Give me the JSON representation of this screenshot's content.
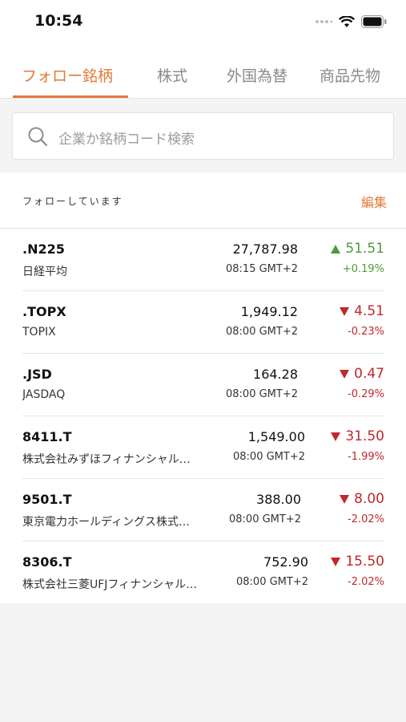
{
  "status_bar": {
    "time": "10:54"
  },
  "tabs": [
    {
      "label": "フォロー銘柄",
      "active": true
    },
    {
      "label": "株式",
      "active": false
    },
    {
      "label": "外国為替",
      "active": false
    },
    {
      "label": "商品先物",
      "active": false
    }
  ],
  "search": {
    "placeholder": "企業か銘柄コード検索"
  },
  "watchlist": {
    "header_label": "フォローしています",
    "edit_label": "編集",
    "rows": [
      {
        "symbol": ".N225",
        "name": "日経平均",
        "price": "27,787.98",
        "time": "08:15 GMT+2",
        "direction": "up",
        "change": "51.51",
        "percent": "+0.19%"
      },
      {
        "symbol": ".TOPX",
        "name": "TOPIX",
        "price": "1,949.12",
        "time": "08:00 GMT+2",
        "direction": "down",
        "change": "4.51",
        "percent": "-0.23%"
      },
      {
        "symbol": ".JSD",
        "name": "JASDAQ",
        "price": "164.28",
        "time": "08:00 GMT+2",
        "direction": "down",
        "change": "0.47",
        "percent": "-0.29%"
      },
      {
        "symbol": "8411.T",
        "name": "株式会社みずほフィナンシャル…",
        "price": "1,549.00",
        "time": "08:00 GMT+2",
        "direction": "down",
        "change": "31.50",
        "percent": "-1.99%"
      },
      {
        "symbol": "9501.T",
        "name": "東京電力ホールディングス株式…",
        "price": "388.00",
        "time": "08:00 GMT+2",
        "direction": "down",
        "change": "8.00",
        "percent": "-2.02%"
      },
      {
        "symbol": "8306.T",
        "name": "株式会社三菱UFJフィナンシャル…",
        "price": "752.90",
        "time": "08:00 GMT+2",
        "direction": "down",
        "change": "15.50",
        "percent": "-2.02%"
      }
    ]
  },
  "colors": {
    "accent": "#e07a3a",
    "up": "#4c9a3a",
    "down": "#c0282e"
  }
}
